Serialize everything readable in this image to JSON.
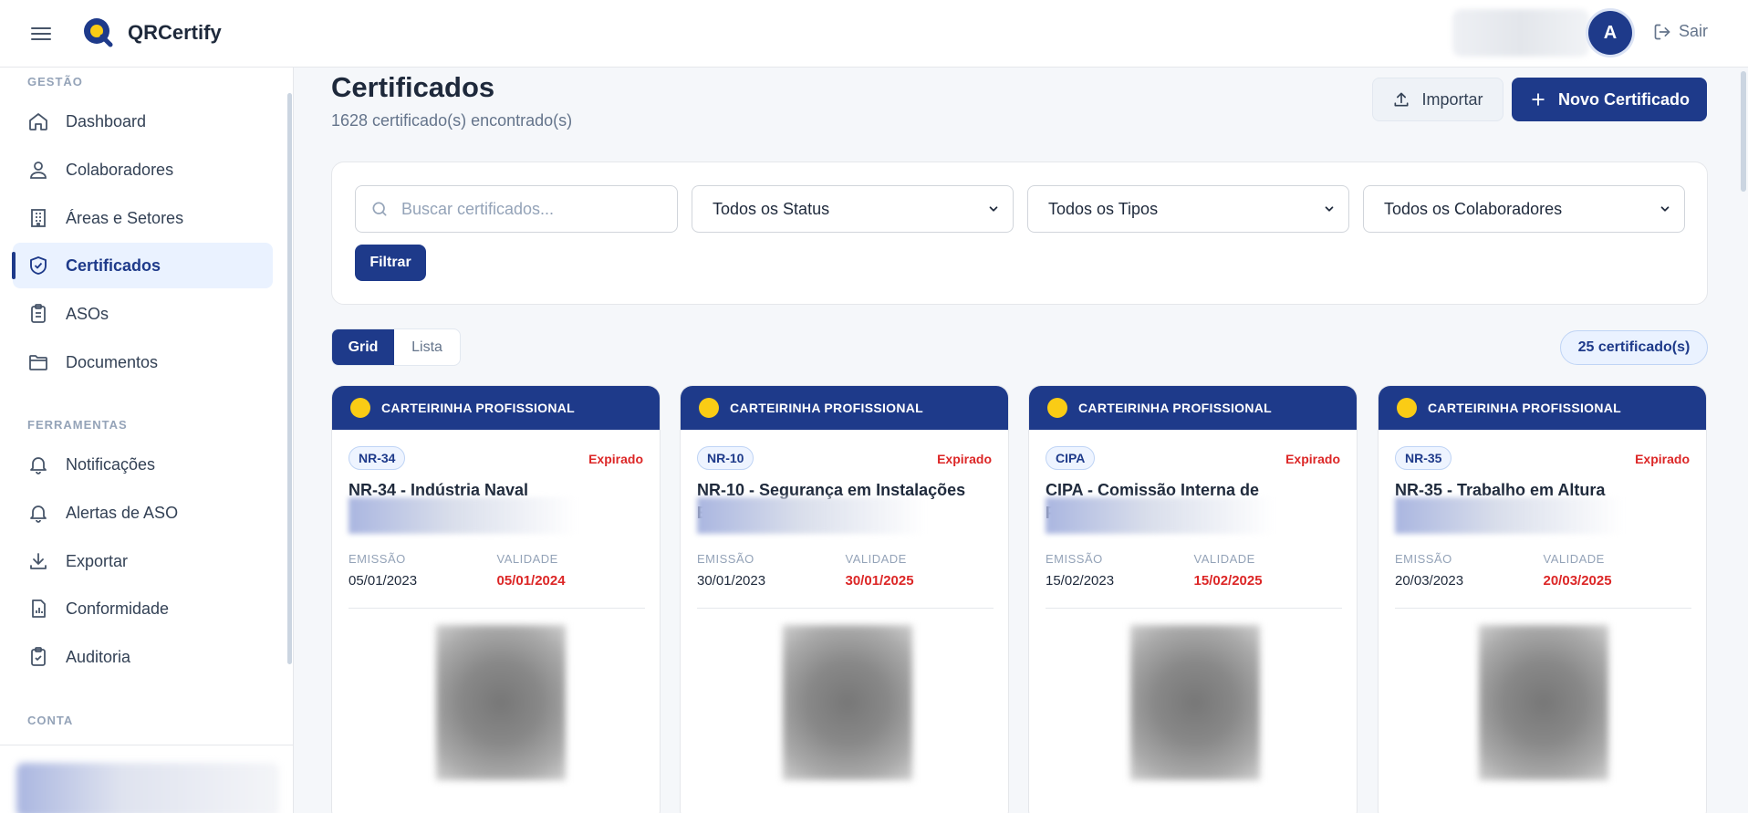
{
  "app": {
    "brand": "QRCertify"
  },
  "topbar": {
    "avatar_initial": "A",
    "logout_label": "Sair"
  },
  "sidebar": {
    "sections": [
      {
        "title": "GESTÃO",
        "items": [
          {
            "label": "Dashboard",
            "icon": "home-icon"
          },
          {
            "label": "Colaboradores",
            "icon": "user-icon"
          },
          {
            "label": "Áreas e Setores",
            "icon": "building-icon"
          },
          {
            "label": "Certificados",
            "icon": "shield-check-icon",
            "active": true
          },
          {
            "label": "ASOs",
            "icon": "clipboard-icon"
          },
          {
            "label": "Documentos",
            "icon": "folder-icon"
          }
        ]
      },
      {
        "title": "FERRAMENTAS",
        "items": [
          {
            "label": "Notificações",
            "icon": "bell-icon"
          },
          {
            "label": "Alertas de ASO",
            "icon": "bell-icon"
          },
          {
            "label": "Exportar",
            "icon": "download-icon"
          },
          {
            "label": "Conformidade",
            "icon": "chart-file-icon"
          },
          {
            "label": "Auditoria",
            "icon": "clipboard-check-icon"
          }
        ]
      },
      {
        "title": "CONTA",
        "items": []
      }
    ]
  },
  "main": {
    "title": "Certificados",
    "subtitle": "1628 certificado(s) encontrado(s)",
    "import_label": "Importar",
    "new_label": "Novo Certificado",
    "filters": {
      "search_placeholder": "Buscar certificados...",
      "status": "Todos os Status",
      "type": "Todos os Tipos",
      "collaborator": "Todos os Colaboradores",
      "filter_button": "Filtrar"
    },
    "view": {
      "grid": "Grid",
      "list": "Lista"
    },
    "count_pill": "25 certificado(s)",
    "date_labels": {
      "emission": "EMISSÃO",
      "validity": "VALIDADE"
    },
    "cards": [
      {
        "category": "CARTEIRINHA PROFISSIONAL",
        "code": "NR-34",
        "status": "Expirado",
        "title": "NR-34 - Indústria Naval",
        "emission": "05/01/2023",
        "validity": "05/01/2024"
      },
      {
        "category": "CARTEIRINHA PROFISSIONAL",
        "code": "NR-10",
        "status": "Expirado",
        "title": "NR-10 - Segurança em Instalações Elétricas",
        "emission": "30/01/2023",
        "validity": "30/01/2025"
      },
      {
        "category": "CARTEIRINHA PROFISSIONAL",
        "code": "CIPA",
        "status": "Expirado",
        "title": "CIPA - Comissão Interna de Prevenção",
        "emission": "15/02/2023",
        "validity": "15/02/2025"
      },
      {
        "category": "CARTEIRINHA PROFISSIONAL",
        "code": "NR-35",
        "status": "Expirado",
        "title": "NR-35 - Trabalho em Altura",
        "emission": "20/03/2023",
        "validity": "20/03/2025"
      }
    ]
  },
  "colors": {
    "primary": "#1e3a8a",
    "accent": "#facc15",
    "danger": "#dc2626"
  }
}
